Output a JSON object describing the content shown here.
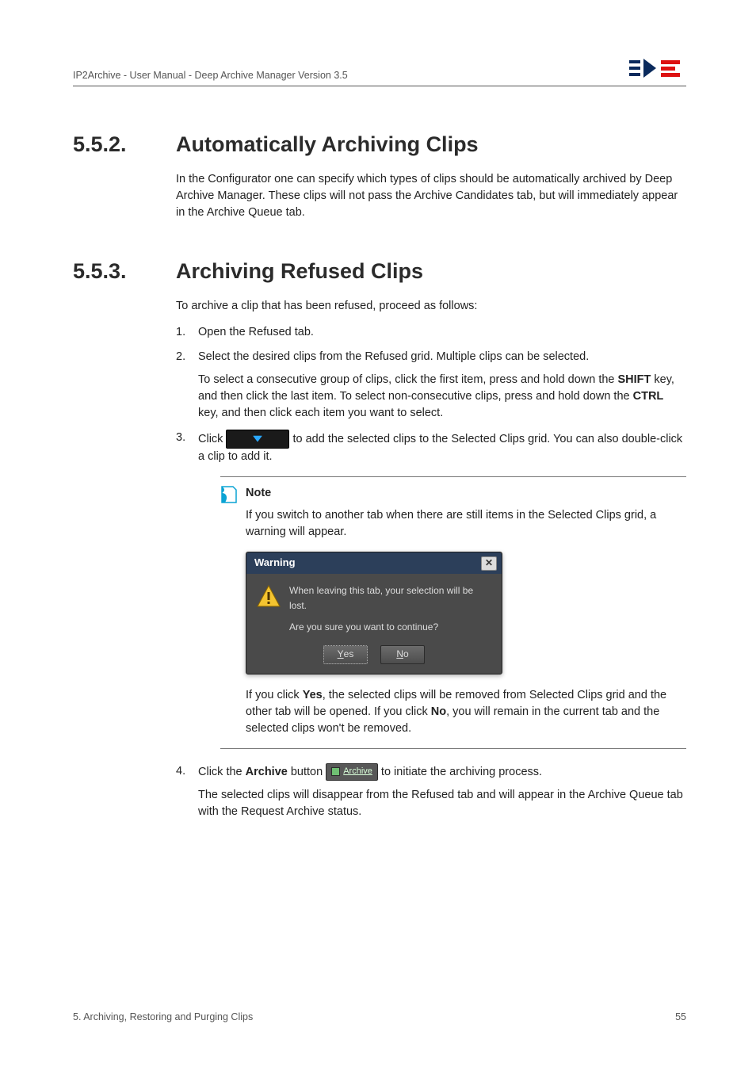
{
  "header": {
    "breadcrumb": "IP2Archive - User Manual - Deep Archive Manager Version 3.5"
  },
  "section1": {
    "num": "5.5.2.",
    "title": "Automatically Archiving Clips",
    "p1": "In the Configurator one can specify which types of clips should be automatically archived by Deep Archive Manager. These clips will not pass the Archive Candidates tab, but will immediately appear in the Archive Queue tab."
  },
  "section2": {
    "num": "5.5.3.",
    "title": "Archiving Refused Clips",
    "intro": "To archive a clip that has been refused, proceed as follows:",
    "step1": "Open the Refused tab.",
    "step2": "Select the desired clips from the Refused grid. Multiple clips can be selected.",
    "step2a_1": "To select a consecutive group of clips, click the first item, press and hold down the ",
    "step2a_shift": "SHIFT",
    "step2a_2": " key, and then click the last item. To select non-consecutive clips, press and hold down the ",
    "step2a_ctrl": "CTRL",
    "step2a_3": " key, and then click each item you want to select.",
    "step3_pre": "Click ",
    "step3_post": " to add the selected clips to the Selected Clips grid. You can also double-click a clip to add it.",
    "note_label": "Note",
    "note_text": "If you switch to another tab when there are still items in the Selected Clips grid, a warning will appear.",
    "dialog": {
      "title": "Warning",
      "line1": "When leaving this tab, your selection will be lost.",
      "line2": "Are you sure you want to continue?",
      "yes_u": "Y",
      "yes_rest": "es",
      "no_u": "N",
      "no_rest": "o"
    },
    "note_after_1": "If you click ",
    "note_after_yes": "Yes",
    "note_after_2": ", the selected clips will be removed from Selected Clips grid and the other tab will be opened. If you click ",
    "note_after_no": "No",
    "note_after_3": ", you will remain in the current tab and the selected clips won't be removed.",
    "step4_pre": "Click the ",
    "step4_archive_word": "Archive",
    "step4_mid": " button ",
    "step4_post": " to initiate the archiving process.",
    "step4_result": "The selected clips will disappear from the Refused tab and will appear in the Archive Queue tab with the Request Archive status.",
    "archive_btn_label": "Archive"
  },
  "footer": {
    "left": "5. Archiving, Restoring and Purging Clips",
    "right": "55"
  }
}
